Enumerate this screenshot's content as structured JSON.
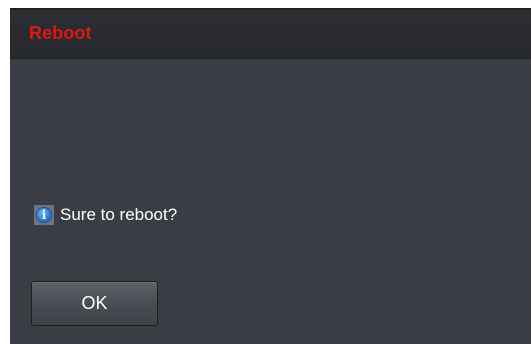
{
  "dialog": {
    "title": "Reboot",
    "title_color": "#e01515",
    "background_color": "#3a3d44",
    "message": {
      "icon": "info-icon",
      "icon_glyph": "i",
      "text": "Sure to reboot?"
    },
    "buttons": {
      "ok_label": "OK"
    }
  }
}
